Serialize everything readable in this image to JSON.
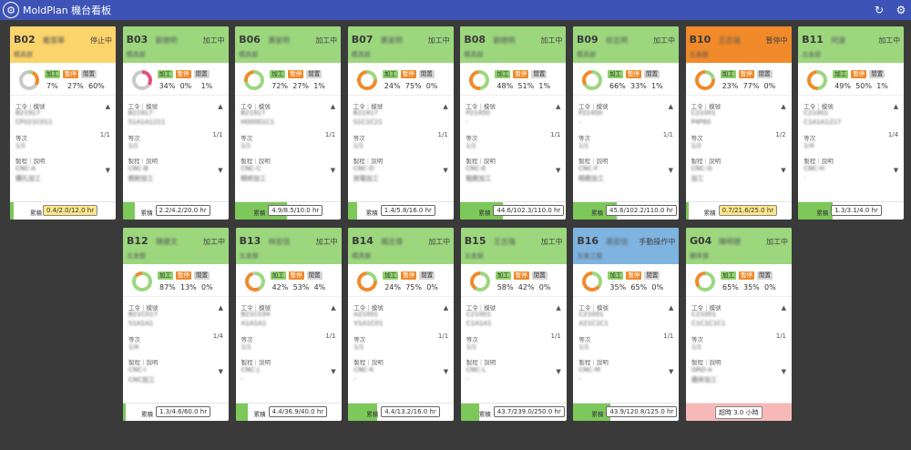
{
  "app": {
    "title": "MoldPlan 機台看板",
    "logo_icon": "gear-logo-icon",
    "refresh_icon": "refresh-icon",
    "settings_icon": "settings-icon"
  },
  "labels": {
    "work": "加工",
    "pause": "暫停",
    "idle": "閒置",
    "order_process": "工令｜模號",
    "seq": "等次",
    "part_desc": "製程｜說明",
    "accum": "累積"
  },
  "colors": {
    "working": "#9cd77e",
    "paused": "#f08a2a",
    "stopped": "#fbd46b",
    "manual": "#7fb3e0",
    "idle": "#c9c9c9",
    "pink": "#e0507a",
    "alert": "#f7b8b8"
  },
  "machines": [
    {
      "code": "B02",
      "operator": "戴雲華",
      "status": "停止中",
      "dept": "模具部",
      "work": "7%",
      "pause": "27%",
      "idle": "60%",
      "seq": "1/1",
      "hours": "0.4/2.0/12.0 hr",
      "blur_order": "B21917",
      "blur_mold": "CF021C011",
      "blur_seq": "1/1",
      "blur_part": "CNC-A",
      "blur_desc": "鑽孔加工"
    },
    {
      "code": "B03",
      "operator": "劉德明",
      "status": "加工中",
      "dept": "模具部",
      "work": "34%",
      "pause": "0%",
      "idle": "1%",
      "seq": "1/1",
      "hours": "2.2/4.2/20.0 hr",
      "blur_order": "B21917",
      "blur_mold": "S1A1A1211",
      "blur_seq": "1/1",
      "blur_part": "CNC-B",
      "blur_desc": "銑削加工"
    },
    {
      "code": "B06",
      "operator": "黃家明",
      "status": "加工中",
      "dept": "模具部",
      "work": "72%",
      "pause": "27%",
      "idle": "1%",
      "seq": "1/1",
      "hours": "4.9/8.5/10.0 hr",
      "blur_order": "B21917",
      "blur_mold": "H00001C1",
      "blur_seq": "1/1",
      "blur_part": "CNC-C",
      "blur_desc": "精修加工"
    },
    {
      "code": "B07",
      "operator": "黃家明",
      "status": "加工中",
      "dept": "模具部",
      "work": "24%",
      "pause": "75%",
      "idle": "0%",
      "seq": "1/1",
      "hours": "1.4/5.8/16.0 hr",
      "blur_order": "B21917",
      "blur_mold": "S1C1C21",
      "blur_seq": "1/1",
      "blur_part": "CNC-D",
      "blur_desc": "放電加工"
    },
    {
      "code": "B08",
      "operator": "劉德明",
      "status": "加工中",
      "dept": "模具部",
      "work": "48%",
      "pause": "51%",
      "idle": "1%",
      "seq": "1/1",
      "hours": "44.6/102.3/110.0 hr",
      "blur_order": "P21450",
      "blur_mold": "-",
      "blur_seq": "1/1",
      "blur_part": "CNC-E",
      "blur_desc": "粗銑加工"
    },
    {
      "code": "B09",
      "operator": "徐志明",
      "status": "加工中",
      "dept": "模具部",
      "work": "66%",
      "pause": "33%",
      "idle": "1%",
      "seq": "1/1",
      "hours": "45.6/102.2/110.0 hr",
      "blur_order": "P21450",
      "blur_mold": "-",
      "blur_seq": "1/1",
      "blur_part": "CNC-F",
      "blur_desc": "精銑加工"
    },
    {
      "code": "B10",
      "operator": "王志強",
      "status": "暫停中",
      "dept": "五金部",
      "work": "23%",
      "pause": "77%",
      "idle": "0%",
      "seq": "1/2",
      "hours": "0.7/21.6/25.0 hr",
      "blur_order": "C21001",
      "blur_mold": "P4F60",
      "blur_seq": "1/2",
      "blur_part": "CNC-G",
      "blur_desc": "加工"
    },
    {
      "code": "B11",
      "operator": "阿遠",
      "status": "加工中",
      "dept": "五金部",
      "work": "49%",
      "pause": "50%",
      "idle": "1%",
      "seq": "1/4",
      "hours": "1.3/3.1/4.0 hr",
      "blur_order": "C21001",
      "blur_mold": "C1A1A1217",
      "blur_seq": "1/4",
      "blur_part": "CNC-H",
      "blur_desc": "-"
    },
    {
      "code": "B12",
      "operator": "陳建文",
      "status": "加工中",
      "dept": "五金部",
      "work": "87%",
      "pause": "13%",
      "idle": "0%",
      "seq": "1/4",
      "hours": "1.3/4.6/60.0 hr",
      "blur_order": "B21C017",
      "blur_mold": "S1A1A1",
      "blur_seq": "1/4",
      "blur_part": "CNC-I",
      "blur_desc": "CNC加工"
    },
    {
      "code": "B13",
      "operator": "林宏信",
      "status": "加工中",
      "dept": "五金部",
      "work": "42%",
      "pause": "53%",
      "idle": "4%",
      "seq": "1/1",
      "hours": "4.4/36.9/40.0 hr",
      "blur_order": "B21C034",
      "blur_mold": "A1A1A1",
      "blur_seq": "1/1",
      "blur_part": "CNC-J",
      "blur_desc": "-"
    },
    {
      "code": "B14",
      "operator": "楊志偉",
      "status": "加工中",
      "dept": "模具部",
      "work": "24%",
      "pause": "75%",
      "idle": "0%",
      "seq": "1/1",
      "hours": "4.4/13.2/16.0 hr",
      "blur_order": "A21001",
      "blur_mold": "V1A1C01",
      "blur_seq": "1/1",
      "blur_part": "CNC-K",
      "blur_desc": "-"
    },
    {
      "code": "B15",
      "operator": "王志強",
      "status": "加工中",
      "dept": "五金部",
      "work": "58%",
      "pause": "42%",
      "idle": "0%",
      "seq": "1/1",
      "hours": "43.7/239.0/250.0 hr",
      "blur_order": "C21001",
      "blur_mold": "C1A1A1",
      "blur_seq": "1/1",
      "blur_part": "CNC-L",
      "blur_desc": "-"
    },
    {
      "code": "B16",
      "operator": "蔡宏信",
      "status": "手動操作中",
      "dept": "五金工程",
      "work": "35%",
      "pause": "65%",
      "idle": "0%",
      "seq": "1/1",
      "hours": "43.9/120.8/125.0 hr",
      "blur_order": "C21001",
      "blur_mold": "A21C1C1",
      "blur_seq": "1/1",
      "blur_part": "CNC-M",
      "blur_desc": "-"
    },
    {
      "code": "G04",
      "operator": "陳明德",
      "status": "加工中",
      "dept": "磨床部",
      "work": "65%",
      "pause": "35%",
      "idle": "0%",
      "seq": "1/1",
      "hours": "",
      "alert": "超時 3.0 小時",
      "blur_order": "C21001",
      "blur_mold": "C1C1C1C1",
      "blur_seq": "1/1",
      "blur_part": "GRD-A",
      "blur_desc": "磨床加工"
    }
  ]
}
